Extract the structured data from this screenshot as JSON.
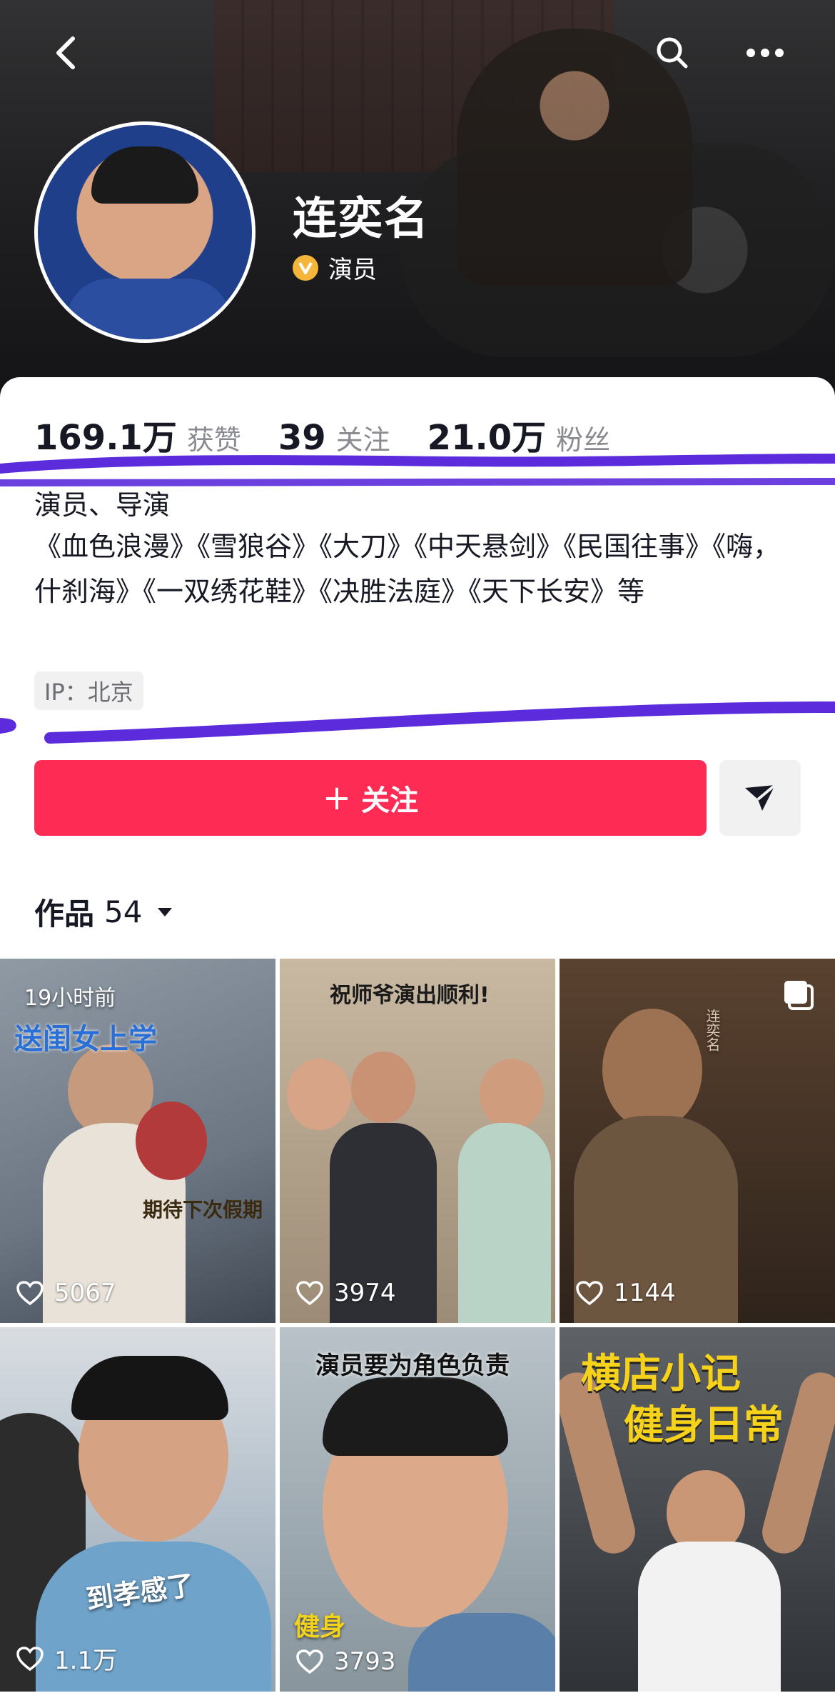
{
  "header": {
    "name": "连奕名",
    "verified_label": "演员",
    "icons": [
      "back-icon",
      "search-icon",
      "more-icon",
      "verified-icon"
    ]
  },
  "stats": {
    "likes": {
      "value": "169.1万",
      "label": "获赞"
    },
    "following": {
      "value": "39",
      "label": "关注"
    },
    "followers": {
      "value": "21.0万",
      "label": "粉丝"
    }
  },
  "bio": {
    "role": "演员、导演",
    "works": "《血色浪漫》《雪狼谷》《大刀》《中天悬剑》《民国往事》《嗨，什刹海》《一双绣花鞋》《决胜法庭》《天下长安》等",
    "ip": "IP：北京"
  },
  "actions": {
    "follow_label": "关注",
    "follow_plus": "+",
    "share_icon": "share-send-icon"
  },
  "works_tab": {
    "label": "作品",
    "count": "54"
  },
  "colors": {
    "follow_button": "#fe2c55",
    "verified_badge": "#f5b53a",
    "annotation_stroke": "#5b2bdc"
  },
  "videos": [
    {
      "likes": "5067",
      "time": "19小时前",
      "caption": "期待下次假期",
      "title": "送闺女上学"
    },
    {
      "likes": "3974",
      "caption": "祝师爷演出顺利!"
    },
    {
      "likes": "1144",
      "multi": true,
      "caption": "连奕名"
    },
    {
      "likes": "1.1万",
      "caption": "到孝感了"
    },
    {
      "likes": "3793",
      "caption": "演员要为角色负责",
      "sub": "健身"
    },
    {
      "likes": "",
      "caption": "横店小记",
      "sub": "健身日常"
    }
  ]
}
